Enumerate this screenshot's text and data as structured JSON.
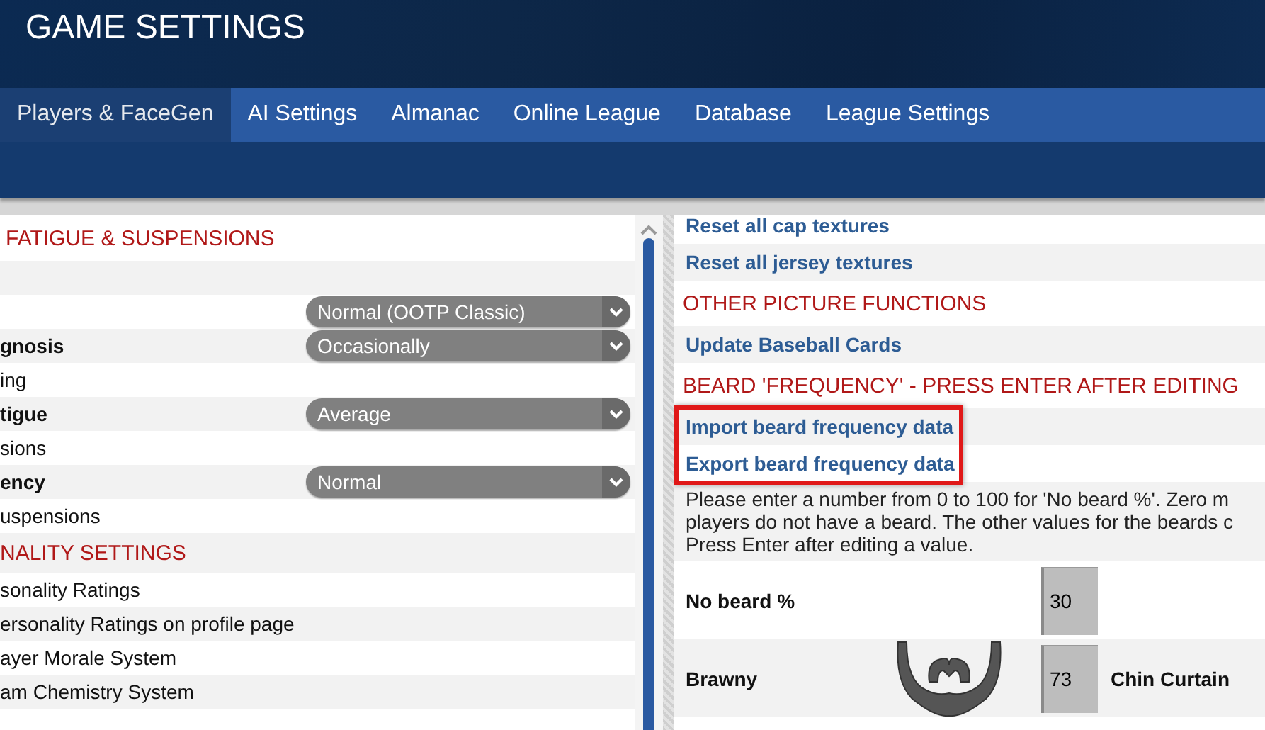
{
  "title": "GAME SETTINGS",
  "tabs": [
    {
      "label": "Players & FaceGen",
      "selected": true
    },
    {
      "label": "AI Settings",
      "selected": false
    },
    {
      "label": "Almanac",
      "selected": false
    },
    {
      "label": "Online League",
      "selected": false
    },
    {
      "label": "Database",
      "selected": false
    },
    {
      "label": "League Settings",
      "selected": false
    }
  ],
  "left_panel": {
    "rows": [
      {
        "kind": "heading",
        "label": "FATIGUE & SUSPENSIONS"
      },
      {
        "kind": "blank"
      },
      {
        "kind": "setting",
        "dropdown": "Normal (OOTP Classic)"
      },
      {
        "kind": "setting",
        "label": "gnosis",
        "bold": true,
        "dropdown": "Occasionally"
      },
      {
        "kind": "setting",
        "label": "ing",
        "bold": false
      },
      {
        "kind": "setting",
        "label": "tigue",
        "bold": true,
        "dropdown": "Average"
      },
      {
        "kind": "setting",
        "label": "sions",
        "bold": false
      },
      {
        "kind": "setting",
        "label": "ency",
        "bold": true,
        "dropdown": "Normal"
      },
      {
        "kind": "setting",
        "label": "uspensions",
        "bold": false
      },
      {
        "kind": "heading",
        "label": "NALITY SETTINGS"
      },
      {
        "kind": "setting",
        "label": "sonality Ratings",
        "bold": false
      },
      {
        "kind": "setting",
        "label": "ersonality Ratings on profile page",
        "bold": false
      },
      {
        "kind": "setting",
        "label": "ayer Morale System",
        "bold": false
      },
      {
        "kind": "setting",
        "label": "am Chemistry System",
        "bold": false
      }
    ]
  },
  "right_panel": {
    "rows": [
      {
        "kind": "link",
        "label": "Reset all cap textures",
        "highlighted": false
      },
      {
        "kind": "link",
        "label": "Reset all jersey textures",
        "highlighted": false
      },
      {
        "kind": "heading",
        "label": "OTHER PICTURE FUNCTIONS"
      },
      {
        "kind": "link",
        "label": "Update Baseball Cards",
        "highlighted": false
      },
      {
        "kind": "heading",
        "label": "BEARD 'FREQUENCY' - PRESS ENTER AFTER EDITING"
      },
      {
        "kind": "link",
        "label": "Import beard frequency data",
        "highlighted": true
      },
      {
        "kind": "link",
        "label": "Export beard frequency data",
        "highlighted": true
      },
      {
        "kind": "note",
        "lines": [
          "Please enter a number from 0 to 100 for 'No beard %'. Zero m",
          "players do not have a beard. The other values for the beards c",
          "Press Enter after editing a value."
        ]
      },
      {
        "kind": "beard",
        "label": "No beard %",
        "value": "30"
      },
      {
        "kind": "beard",
        "label": "Brawny",
        "value": "73",
        "style": "Chin Curtain"
      }
    ]
  }
}
